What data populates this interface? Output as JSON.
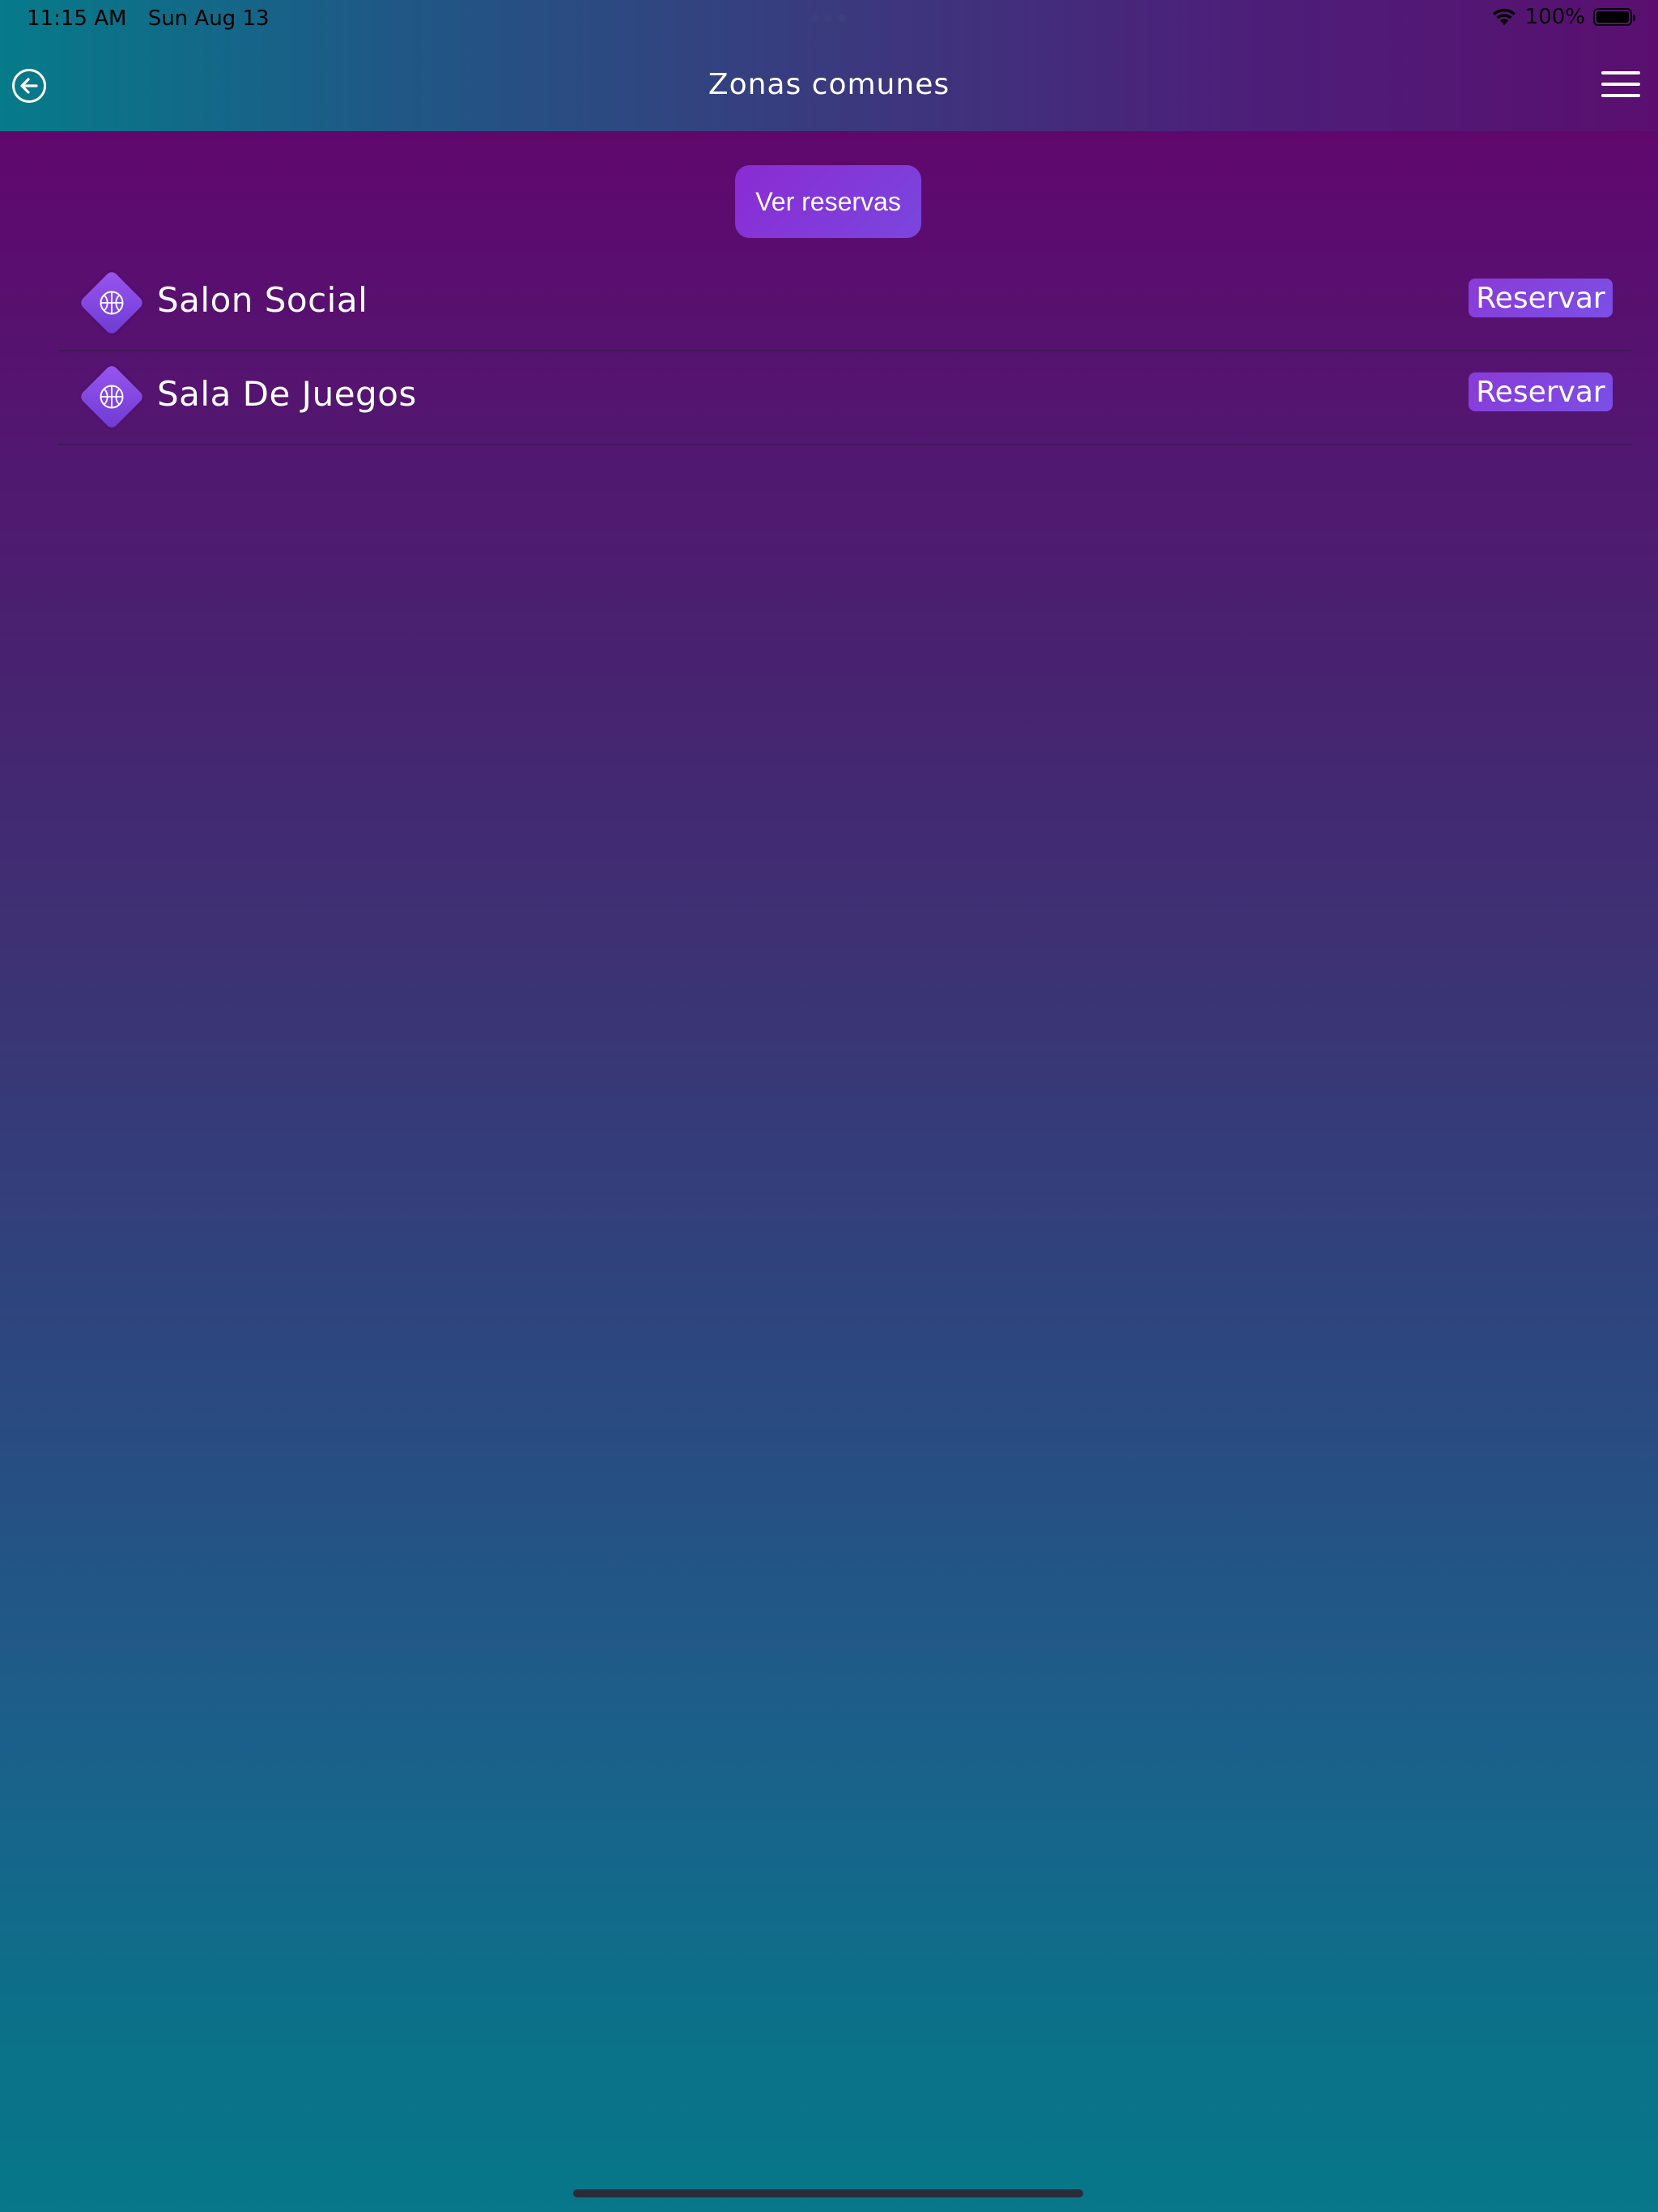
{
  "status_bar": {
    "time": "11:15 AM",
    "date": "Sun Aug 13",
    "battery": "100%",
    "battery_level": 1.0
  },
  "header": {
    "title": "Zonas comunes",
    "back_icon": "arrow-left-circle-icon",
    "menu_icon": "hamburger-menu-icon"
  },
  "actions": {
    "view_reservations_label": "Ver reservas"
  },
  "zones": [
    {
      "name": "Salon Social",
      "icon": "basketball-icon",
      "reserve_label": "Reservar"
    },
    {
      "name": "Sala De Juegos",
      "icon": "basketball-icon",
      "reserve_label": "Reservar"
    }
  ],
  "colors": {
    "accent": "#7a46de",
    "icon_tile": "#8a4ae6"
  }
}
